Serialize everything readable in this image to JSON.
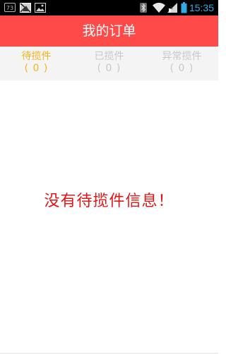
{
  "status_bar": {
    "badge": "73",
    "time": "15:35",
    "icons": [
      "notification-badge-icon",
      "mail-icon",
      "image-icon",
      "bluetooth-icon",
      "wifi-icon",
      "signal-icon",
      "battery-icon"
    ],
    "accent_color": "#35a8e6"
  },
  "header": {
    "title": "我的订单",
    "background_color": "#ff4a4a"
  },
  "tabs": [
    {
      "label": "待揽件",
      "count": "( 0 )",
      "active": true
    },
    {
      "label": "已揽件",
      "count": "( 0 )",
      "active": false
    },
    {
      "label": "异常揽件",
      "count": "( 0 )",
      "active": false
    }
  ],
  "tab_colors": {
    "active": "#f3b41f",
    "inactive": "#c8c8c8"
  },
  "main": {
    "empty_message": "没有待揽件信息！",
    "message_color": "#e01515"
  }
}
